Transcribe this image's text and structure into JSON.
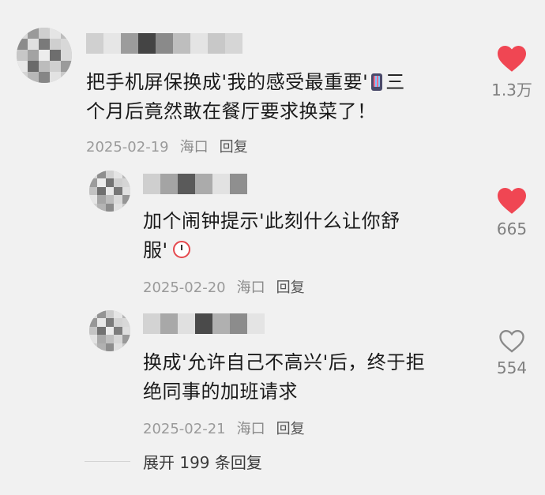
{
  "comments": [
    {
      "text_line1": "把手机屏保换成'我的感受最重要'",
      "text_line1_tail": "三",
      "text_line2": "个月后竟然敢在餐厅要求换菜了！",
      "date": "2025-02-19",
      "location": "海口",
      "reply_label": "回复",
      "likes": "1.3万",
      "liked": true
    },
    {
      "text_line1": "加个闹钟提示'此刻什么让你舒",
      "text_line2": "服'",
      "date": "2025-02-20",
      "location": "海口",
      "reply_label": "回复",
      "likes": "665",
      "liked": true
    },
    {
      "text_line1": "换成'允许自己不高兴'后，终于拒",
      "text_line2": "绝同事的加班请求",
      "date": "2025-02-21",
      "location": "海口",
      "reply_label": "回复",
      "likes": "554",
      "liked": false
    }
  ],
  "expand_replies_label": "展开 199 条回复",
  "colors": {
    "liked_heart": "#f04653",
    "unliked_heart": "#8a8a8a",
    "background": "#f1f1f1"
  },
  "icons": [
    "heart-filled-icon",
    "heart-outline-icon",
    "phone-emoji-icon",
    "alarm-clock-emoji-icon"
  ]
}
